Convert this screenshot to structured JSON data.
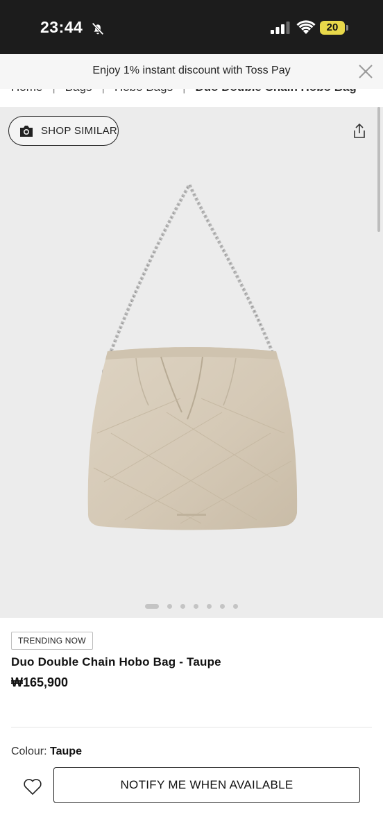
{
  "status_bar": {
    "time": "23:44",
    "battery": "20",
    "icons": [
      "bell-off-icon",
      "signal-icon",
      "wifi-icon",
      "battery-icon"
    ]
  },
  "promo": {
    "text": "Enjoy 1% instant discount with Toss Pay",
    "close_icon": "close-icon"
  },
  "breadcrumb": {
    "items": [
      "Home",
      "Bags",
      "Hobo Bags",
      "Duo Double Chain Hobo Bag"
    ]
  },
  "gallery": {
    "shop_similar_label": "SHOP SIMILAR",
    "shop_similar_icon": "camera-icon",
    "share_icon": "share-icon",
    "image_count": 7,
    "active_index": 0,
    "bag_color": "#d8cdbb"
  },
  "product": {
    "badge": "TRENDING NOW",
    "name": "Duo Double Chain Hobo Bag - Taupe",
    "price": "₩165,900",
    "colour_label": "Colour:",
    "colour_value": "Taupe"
  },
  "actions": {
    "wishlist_icon": "heart-icon",
    "notify_label": "NOTIFY ME WHEN AVAILABLE"
  }
}
